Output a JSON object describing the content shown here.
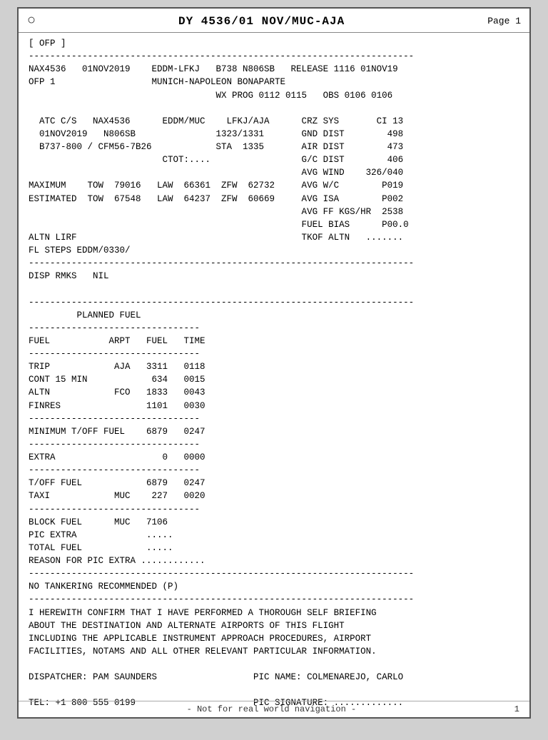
{
  "header": {
    "icon": "○",
    "title": "DY 4536/01 NOV/MUC-AJA",
    "page": "Page 1"
  },
  "footer": {
    "left": "",
    "center": "- Not for real world navigation -",
    "right": "1"
  },
  "content": "[ OFP ]\n------------------------------------------------------------------------\nNAX4536   01NOV2019    EDDM-LFKJ   B738 N806SB   RELEASE 1116 01NOV19\nOFP 1                  MUNICH-NAPOLEON BONAPARTE\n                                   WX PROG 0112 0115   OBS 0106 0106\n\n  ATC C/S   NAX4536      EDDM/MUC    LFKJ/AJA      CRZ SYS       CI 13\n  01NOV2019   N806SB               1323/1331       GND DIST        498\n  B737-800 / CFM56-7B26            STA  1335       AIR DIST        473\n                         CTOT:....                 G/C DIST        406\n                                                   AVG WIND    326/040\nMAXIMUM    TOW  79016   LAW  66361  ZFW  62732     AVG W/C        P019\nESTIMATED  TOW  67548   LAW  64237  ZFW  60669     AVG ISA        P002\n                                                   AVG FF KGS/HR  2538\n                                                   FUEL BIAS      P00.0\nALTN LIRF                                          TKOF ALTN   .......\nFL STEPS EDDM/0330/\n------------------------------------------------------------------------\nDISP RMKS   NIL\n\n------------------------------------------------------------------------\n         PLANNED FUEL\n--------------------------------\nFUEL           ARPT   FUEL   TIME\n--------------------------------\nTRIP            AJA   3311   0118\nCONT 15 MIN            634   0015\nALTN            FCO   1833   0043\nFINRES                1101   0030\n--------------------------------\nMINIMUM T/OFF FUEL    6879   0247\n--------------------------------\nEXTRA                    0   0000\n--------------------------------\nT/OFF FUEL            6879   0247\nTAXI            MUC    227   0020\n--------------------------------\nBLOCK FUEL      MUC   7106\nPIC EXTRA             .....\nTOTAL FUEL            .....\nREASON FOR PIC EXTRA ............\n------------------------------------------------------------------------\nNO TANKERING RECOMMENDED (P)\n------------------------------------------------------------------------\nI HEREWITH CONFIRM THAT I HAVE PERFORMED A THOROUGH SELF BRIEFING\nABOUT THE DESTINATION AND ALTERNATE AIRPORTS OF THIS FLIGHT\nINCLUDING THE APPLICABLE INSTRUMENT APPROACH PROCEDURES, AIRPORT\nFACILITIES, NOTAMS AND ALL OTHER RELEVANT PARTICULAR INFORMATION.\n\nDISPATCHER: PAM SAUNDERS                  PIC NAME: COLMENAREJO, CARLO\n\nTEL: +1 800 555 0199                      PIC SIGNATURE: ............."
}
